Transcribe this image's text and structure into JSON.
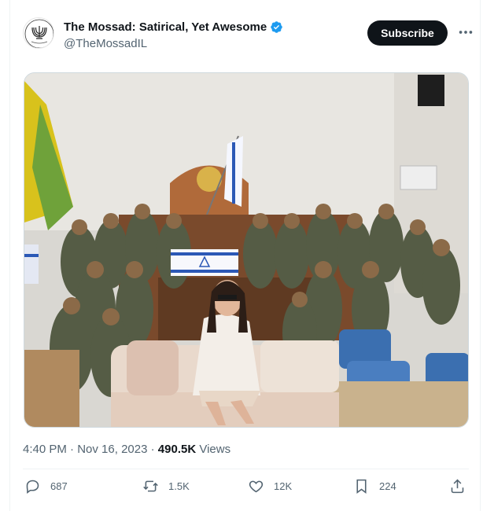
{
  "tweet": {
    "author_name": "The Mossad: Satirical, Yet Awesome",
    "handle": "@TheMossadIL",
    "subscribe_label": "Subscribe",
    "time": "4:40 PM",
    "date": "Nov 16, 2023",
    "separator": "·",
    "views_count": "490.5K",
    "views_label": "Views"
  },
  "actions": {
    "replies": "687",
    "reposts": "1.5K",
    "likes": "12K",
    "bookmarks": "224"
  },
  "colors": {
    "verified": "#1d9bf0",
    "text_secondary": "#536471",
    "button_bg": "#0f1419"
  },
  "icons": [
    "menorah-emblem-icon",
    "verified-badge-icon",
    "more-icon",
    "reply-icon",
    "repost-icon",
    "like-icon",
    "bookmark-icon",
    "share-icon"
  ]
}
